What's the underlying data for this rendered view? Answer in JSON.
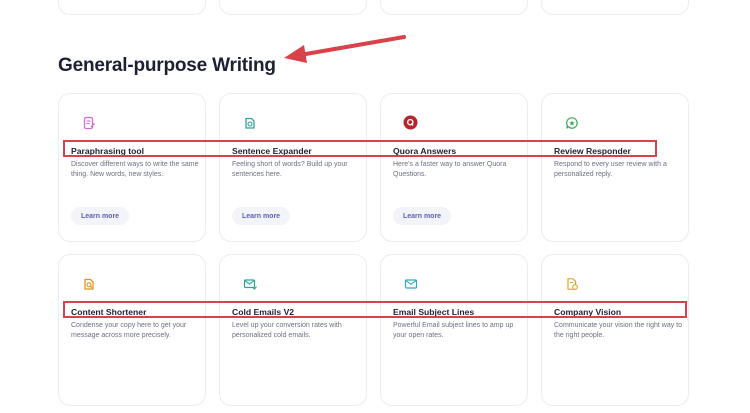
{
  "section": {
    "title": "General-purpose Writing"
  },
  "colors": {
    "highlight": "#d9424b",
    "accent": "#5a5fb5"
  },
  "cards": [
    {
      "name": "paraphrasing-tool",
      "title": "Paraphrasing tool",
      "desc": "Discover different ways to write the same thing. New words, new styles.",
      "button": "Learn more",
      "icon": "doc-edit-icon"
    },
    {
      "name": "sentence-expander",
      "title": "Sentence Expander",
      "desc": "Feeling short of words? Build up your sentences here.",
      "button": "Learn more",
      "icon": "expand-doc-icon"
    },
    {
      "name": "quora-answers",
      "title": "Quora Answers",
      "desc": "Here's a faster way to answer Quora Questions.",
      "button": "Learn more",
      "icon": "quora-icon"
    },
    {
      "name": "review-responder",
      "title": "Review Responder",
      "desc": "Respond to every user review with a personalized reply.",
      "button": "",
      "icon": "chat-star-icon"
    },
    {
      "name": "content-shortener",
      "title": "Content Shortener",
      "desc": "Condense your copy here to get your message across more precisely.",
      "button": "",
      "icon": "shorten-icon"
    },
    {
      "name": "cold-emails-v2",
      "title": "Cold Emails V2",
      "desc": "Level up your conversion rates with personalized cold emails.",
      "button": "",
      "icon": "mail-icon"
    },
    {
      "name": "email-subject-lines",
      "title": "Email Subject Lines",
      "desc": "Powerful Email subject lines to amp up your open rates.",
      "button": "",
      "icon": "mail-check-icon"
    },
    {
      "name": "company-vision",
      "title": "Company Vision",
      "desc": "Communicate your vision the right way to the right people.",
      "button": "",
      "icon": "doc-vision-icon"
    }
  ]
}
